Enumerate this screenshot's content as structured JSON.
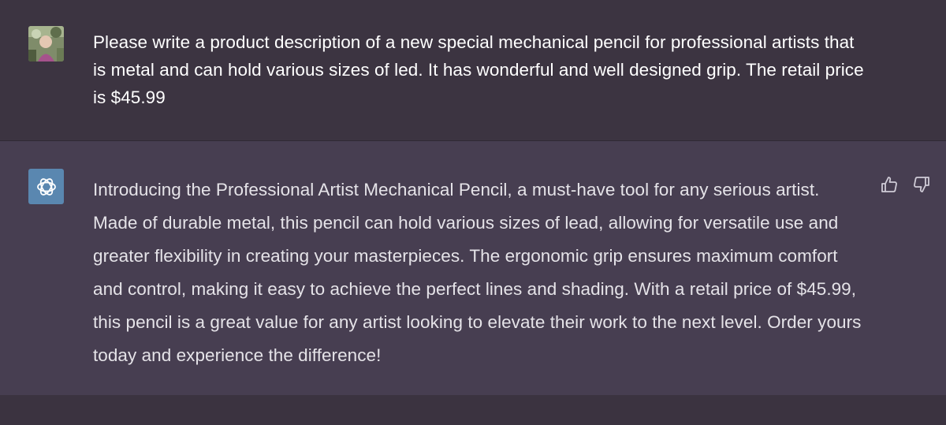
{
  "conversation": {
    "user_message": {
      "avatar_icon": "user-avatar-photo",
      "text": "Please write a product description of a new special mechanical pencil for professional artists that is metal and can hold various sizes of led. It has wonderful and well designed grip. The retail price is $45.99"
    },
    "assistant_message": {
      "avatar_icon": "openai-logo-icon",
      "avatar_color": "#5a87b0",
      "text": "Introducing the Professional Artist Mechanical Pencil, a must-have tool for any serious artist. Made of durable metal, this pencil can hold various sizes of lead, allowing for versatile use and greater flexibility in creating your masterpieces. The ergonomic grip ensures maximum comfort and control, making it easy to achieve the perfect lines and shading. With a retail price of $45.99, this pencil is a great value for any artist looking to elevate their work to the next level. Order yours today and experience the difference!",
      "actions": [
        {
          "icon": "thumbs-up-icon"
        },
        {
          "icon": "thumbs-down-icon"
        }
      ]
    }
  },
  "colors": {
    "user_bg": "#3c3441",
    "assistant_bg": "#473e51",
    "user_text": "#ffffff",
    "assistant_text": "#e5e3e8"
  }
}
